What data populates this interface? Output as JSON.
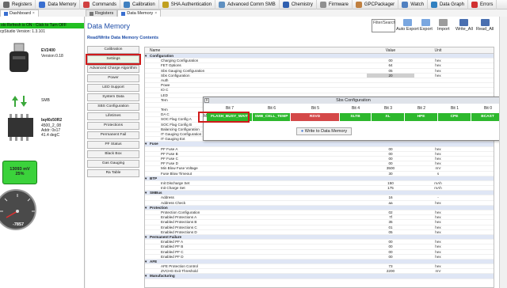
{
  "toolbar": {
    "items": [
      {
        "label": "Registers",
        "icon": "registers-icon",
        "color": "#6a6a6a"
      },
      {
        "label": "Data Memory",
        "icon": "data-memory-icon",
        "color": "#3a6fd0"
      },
      {
        "label": "Commands",
        "icon": "commands-icon",
        "color": "#d04040"
      },
      {
        "label": "Calibration",
        "icon": "calibration-icon",
        "color": "#4080c0"
      },
      {
        "label": "SHA Authentication",
        "icon": "sha-icon",
        "color": "#c0a020"
      },
      {
        "label": "Advanced Comm SMB",
        "icon": "smb-icon",
        "color": "#6090c0"
      },
      {
        "label": "Chemistry",
        "icon": "chemistry-icon",
        "color": "#3060b0"
      },
      {
        "label": "Firmware",
        "icon": "firmware-icon",
        "color": "#909090"
      },
      {
        "label": "GPCPackager",
        "icon": "package-icon",
        "color": "#c08040"
      },
      {
        "label": "Watch",
        "icon": "watch-icon",
        "color": "#5080c0"
      },
      {
        "label": "Data Graph",
        "icon": "graph-icon",
        "color": "#3080c0"
      },
      {
        "label": "Errors",
        "icon": "errors-icon",
        "color": "#d03030"
      }
    ]
  },
  "tabs": {
    "dashboard": "Dashboard",
    "registers": "Registers",
    "data_memory": "Data Memory"
  },
  "left": {
    "green_bar": "olo Refresh is ON - Click to Turn OFF",
    "version": "cpStudio Version:  1.3.101",
    "ev_name": "EV2400",
    "ev_version": "Version:0.18",
    "bus": "SMB",
    "gauge_chip": "bq40z50R2",
    "gauge_fw": "4500_2_08",
    "gauge_addr": "Addr: 0x17",
    "gauge_temp": "41.4 degC",
    "battery_mv": "13093 mV",
    "battery_pct": "25%",
    "current": "-7857"
  },
  "main": {
    "title": "Data Memory",
    "subtitle": "Read/Write Data Memory Contents",
    "filter_label": "Filter/Search",
    "actions": [
      "Auto Export",
      "Export",
      "Import",
      "Write_All",
      "Read_All"
    ]
  },
  "sidebar_buttons": [
    "Calibration",
    "Settings",
    "Advanced Charge Algorithm",
    "Power",
    "LED Support",
    "System Data",
    "SBS Configuration",
    "Lifetimes",
    "Protections",
    "Permanent Fail",
    "PF Status",
    "Black Box",
    "Gas Gauging",
    "Ra Table"
  ],
  "grid": {
    "headers": {
      "name": "Name",
      "value": "Value",
      "unit": "Unit"
    },
    "rows": [
      {
        "sec": true,
        "name": "Configuration",
        "value": "",
        "unit": ""
      },
      {
        "name": "Charging Configuration",
        "value": "00",
        "unit": "hex"
      },
      {
        "name": "FET Options",
        "value": "64",
        "unit": "hex"
      },
      {
        "name": "Sbs Gauging Configuration",
        "value": "05",
        "unit": "hex"
      },
      {
        "name": "Sbs Configuration",
        "value": "20",
        "unit": "hex"
      },
      {
        "name": "Auth",
        "value": "",
        "unit": ""
      },
      {
        "name": "Powe",
        "value": "",
        "unit": ""
      },
      {
        "name": "IO C",
        "value": "",
        "unit": ""
      },
      {
        "name": "LED",
        "value": "",
        "unit": ""
      },
      {
        "name": "Tem",
        "value": "",
        "unit": ""
      },
      {
        "name": "",
        "value": "",
        "unit": ""
      },
      {
        "name": "Tem",
        "value": "",
        "unit": ""
      },
      {
        "name": "DA C",
        "value": "",
        "unit": ""
      },
      {
        "name": "SOC Flag Config A",
        "value": "",
        "unit": "hex"
      },
      {
        "name": "SOC Flag Config B",
        "value": "0c",
        "unit": "hex"
      },
      {
        "name": "Balancing Configuration",
        "value": "01",
        "unit": "hex"
      },
      {
        "name": "IT Gauging Configuration",
        "value": "d07e",
        "unit": "hex"
      },
      {
        "name": "IT Gauging Ext",
        "value": "00fa",
        "unit": "hex"
      },
      {
        "sec": true,
        "name": "Fuse",
        "value": "",
        "unit": ""
      },
      {
        "name": "PF Fuse A",
        "value": "00",
        "unit": "hex"
      },
      {
        "name": "PF Fuse B",
        "value": "00",
        "unit": "hex"
      },
      {
        "name": "PF Fuse C",
        "value": "00",
        "unit": "hex"
      },
      {
        "name": "PF Fuse D",
        "value": "00",
        "unit": "hex"
      },
      {
        "name": "Min Blow Fuse Voltage",
        "value": "3500",
        "unit": "mV"
      },
      {
        "name": "Fuse Blow Timeout",
        "value": "30",
        "unit": "s"
      },
      {
        "sec": true,
        "name": "BTP",
        "value": "",
        "unit": ""
      },
      {
        "name": "Init Discharge Set",
        "value": "150",
        "unit": "mAh"
      },
      {
        "name": "Init Charge Set",
        "value": "175",
        "unit": "mAh"
      },
      {
        "sec": true,
        "name": "SMBus",
        "value": "",
        "unit": ""
      },
      {
        "name": "Address",
        "value": "16",
        "unit": "-"
      },
      {
        "name": "Address Check",
        "value": "aa",
        "unit": "hex"
      },
      {
        "sec": true,
        "name": "Protection",
        "value": "",
        "unit": ""
      },
      {
        "name": "Protection Configuration",
        "value": "02",
        "unit": "hex"
      },
      {
        "name": "Enabled Protections A",
        "value": "7f",
        "unit": "hex"
      },
      {
        "name": "Enabled Protections B",
        "value": "35",
        "unit": "hex"
      },
      {
        "name": "Enabled Protections C",
        "value": "01",
        "unit": "hex"
      },
      {
        "name": "Enabled Protections D",
        "value": "05",
        "unit": "hex"
      },
      {
        "sec": true,
        "name": "Permanent Failure",
        "value": "",
        "unit": ""
      },
      {
        "name": "Enabled PF A",
        "value": "00",
        "unit": "hex"
      },
      {
        "name": "Enabled PF B",
        "value": "00",
        "unit": "hex"
      },
      {
        "name": "Enabled PF C",
        "value": "00",
        "unit": "hex"
      },
      {
        "name": "Enabled PF D",
        "value": "00",
        "unit": "hex"
      },
      {
        "sec": true,
        "name": "AFE",
        "value": "",
        "unit": ""
      },
      {
        "name": "AFE Protection Control",
        "value": "73",
        "unit": "hex"
      },
      {
        "name": "ZVCHG Exit Threshold",
        "value": "2200",
        "unit": "mV"
      },
      {
        "sec": true,
        "name": "Manufacturing",
        "value": "",
        "unit": ""
      }
    ]
  },
  "popup": {
    "title": "Sbs Configuration",
    "row_label": "MS",
    "bits": [
      "Bit 7",
      "Bit 6",
      "Bit 5",
      "Bit 4",
      "Bit 3",
      "Bit 2",
      "Bit 1",
      "Bit 0"
    ],
    "values": [
      "FLASH_BUSY_WAIT",
      "SMB_CELL_TEMP",
      "RSVD",
      "SLTB",
      "XL",
      "HPE",
      "CPE",
      "BCAST"
    ],
    "colors": [
      "#2db82d",
      "#2db82d",
      "#d44848",
      "#2db82d",
      "#2db82d",
      "#2db82d",
      "#2db82d",
      "#2db82d"
    ],
    "write_button": "Write to Data Memory"
  }
}
